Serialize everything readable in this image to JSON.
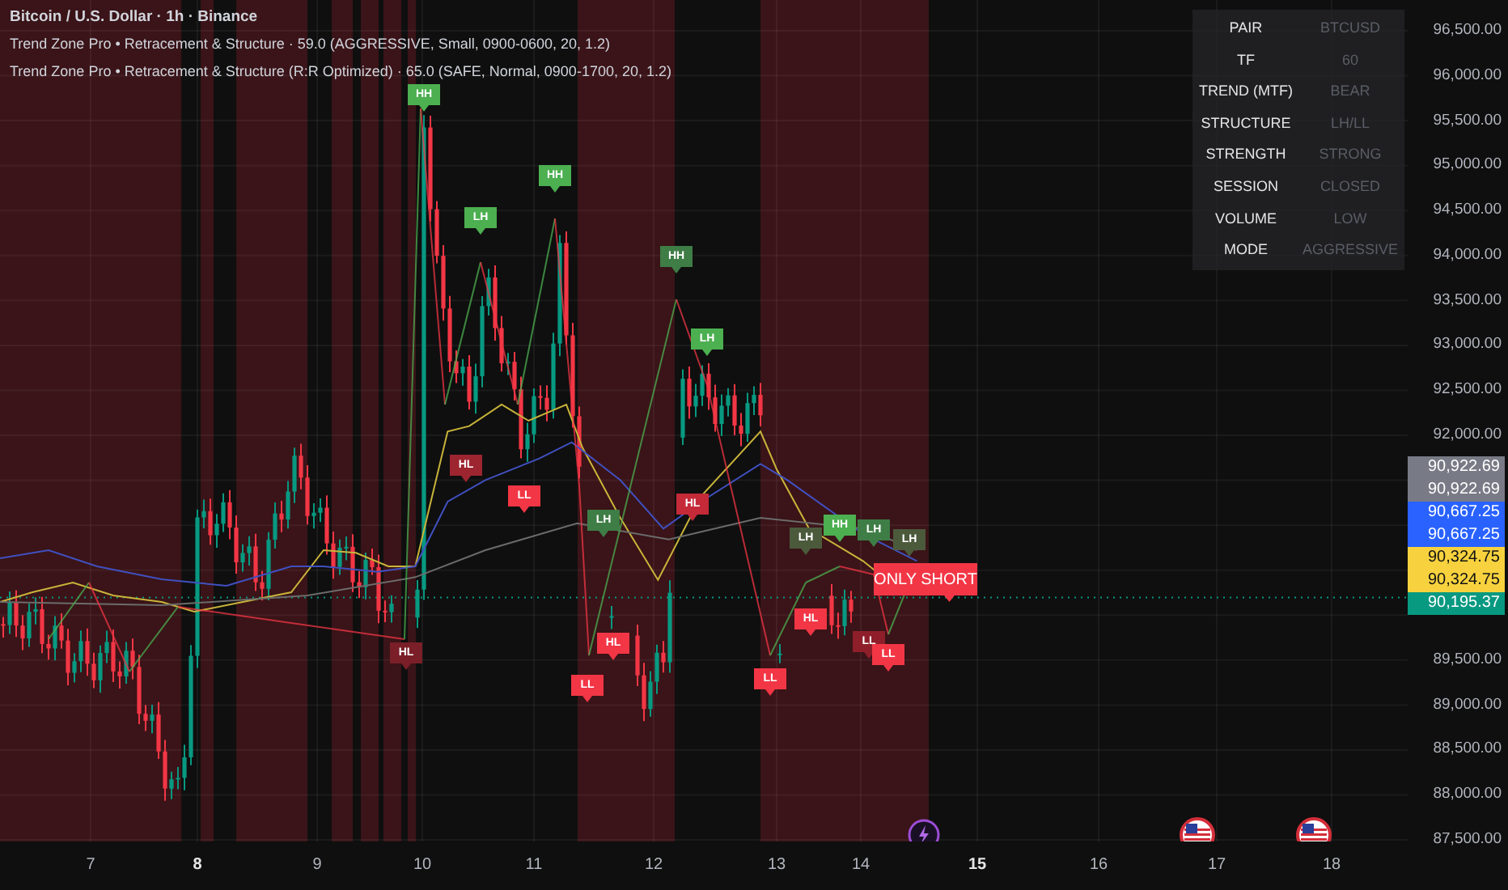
{
  "legend": {
    "symbol": "Bitcoin / U.S. Dollar · 1h · Binance",
    "indicators": [
      "Trend Zone Pro • Retracement & Structure · 59.0 (AGGRESSIVE, Small, 0900-0600, 20, 1.2)",
      "Trend Zone Pro • Retracement & Structure (R:R Optimized) · 65.0 (SAFE, Normal, 0900-1700, 20, 1.2)"
    ]
  },
  "info_table": {
    "rows": [
      {
        "label": "PAIR",
        "value": "BTCUSD"
      },
      {
        "label": "TF",
        "value": "60"
      },
      {
        "label": "TREND (MTF)",
        "value": "BEAR"
      },
      {
        "label": "STRUCTURE",
        "value": "LH/LL"
      },
      {
        "label": "STRENGTH",
        "value": "STRONG"
      },
      {
        "label": "SESSION",
        "value": "CLOSED"
      },
      {
        "label": "VOLUME",
        "value": "LOW"
      },
      {
        "label": "MODE",
        "value": "AGGRESSIVE"
      }
    ]
  },
  "structure_labels": [
    {
      "text": "HH",
      "color": "#4caf50"
    },
    {
      "text": "LH",
      "color": "#4caf50"
    },
    {
      "text": "HH",
      "color": "#4caf50"
    },
    {
      "text": "HH",
      "color": "#3f7d46"
    },
    {
      "text": "LH",
      "color": "#4caf50"
    },
    {
      "text": "HL",
      "color": "#9c2530"
    },
    {
      "text": "LL",
      "color": "#f23645"
    },
    {
      "text": "LH",
      "color": "#3f7d46"
    },
    {
      "text": "HL",
      "color": "#c42a38"
    },
    {
      "text": "HL",
      "color": "#7a1e28"
    },
    {
      "text": "HL",
      "color": "#f23645"
    },
    {
      "text": "LL",
      "color": "#f23645"
    },
    {
      "text": "LL",
      "color": "#f23645"
    },
    {
      "text": "HL",
      "color": "#f23645"
    },
    {
      "text": "LL",
      "color": "#8e1f2a"
    },
    {
      "text": "LL",
      "color": "#f23645"
    },
    {
      "text": "LH",
      "color": "#4c5a3c"
    },
    {
      "text": "HH",
      "color": "#4caf50"
    },
    {
      "text": "LH",
      "color": "#3f7d46"
    },
    {
      "text": "LH",
      "color": "#4c5a3c"
    }
  ],
  "signal": {
    "text": "ONLY SHORT"
  },
  "price_axis": {
    "ticks": [
      "96,500.00",
      "96,000.00",
      "95,500.00",
      "95,000.00",
      "94,500.00",
      "94,000.00",
      "93,500.00",
      "93,000.00",
      "92,500.00",
      "92,000.00",
      "89,500.00",
      "89,000.00",
      "88,500.00",
      "88,000.00",
      "87,500.00"
    ],
    "badges": [
      {
        "text": "90,922.69",
        "color": "#787b86"
      },
      {
        "text": "90,922.69",
        "color": "#787b86"
      },
      {
        "text": "90,667.25",
        "color": "#2962ff"
      },
      {
        "text": "90,667.25",
        "color": "#2962ff"
      },
      {
        "text": "90,324.75",
        "color": "#f7d23e"
      },
      {
        "text": "90,324.75",
        "color": "#f7d23e"
      },
      {
        "text": "90,195.37",
        "color": "#089981"
      }
    ]
  },
  "time_axis": {
    "ticks": [
      {
        "label": "7",
        "bold": false
      },
      {
        "label": "8",
        "bold": true
      },
      {
        "label": "9",
        "bold": false
      },
      {
        "label": "10",
        "bold": false
      },
      {
        "label": "11",
        "bold": false
      },
      {
        "label": "12",
        "bold": false
      },
      {
        "label": "13",
        "bold": false
      },
      {
        "label": "14",
        "bold": false
      },
      {
        "label": "15",
        "bold": true
      },
      {
        "label": "16",
        "bold": false
      },
      {
        "label": "17",
        "bold": false
      },
      {
        "label": "18",
        "bold": false
      }
    ]
  }
}
